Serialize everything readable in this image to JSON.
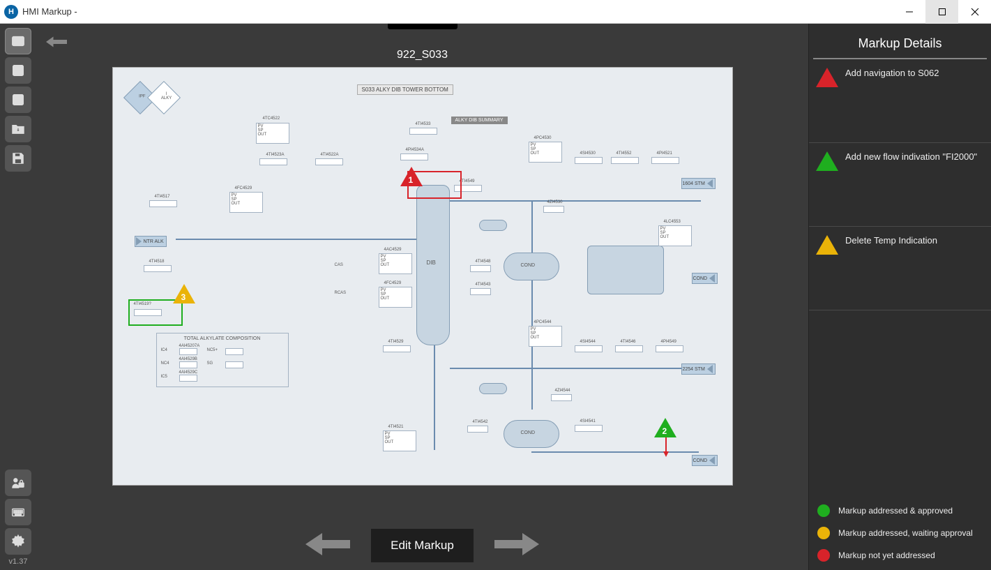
{
  "window": {
    "title": "HMI Markup -"
  },
  "version": "v1.37",
  "doc": {
    "title": "922_S033",
    "header1": "S033      ALKY DIB TOWER BOTTOM",
    "header2": "ALKY DIB SUMMARY",
    "ntr_alk": "NTR ALK",
    "stream1": "1604 STM",
    "stream2": "2254 STM",
    "cond": "COND",
    "dib": "DIB",
    "comp_title": "TOTAL ALKYLATE COMPOSITION",
    "comp_labels": {
      "ic4": "IC4",
      "nc5p": "NC5+",
      "nc4": "NC4",
      "sg": "SG",
      "ic5": "IC5"
    }
  },
  "bottom": {
    "edit": "Edit Markup"
  },
  "panel": {
    "title": "Markup Details",
    "items": [
      {
        "num": "1",
        "color": "red",
        "text": "Add navigation to S062"
      },
      {
        "num": "2",
        "color": "green",
        "text": "Add new flow indivation \"FI2000\""
      },
      {
        "num": "3",
        "color": "yellow",
        "text": "Delete Temp Indication"
      }
    ],
    "legend": {
      "green": "Markup addressed & approved",
      "yellow": "Markup addressed, waiting approval",
      "red": "Markup not yet addressed"
    }
  }
}
